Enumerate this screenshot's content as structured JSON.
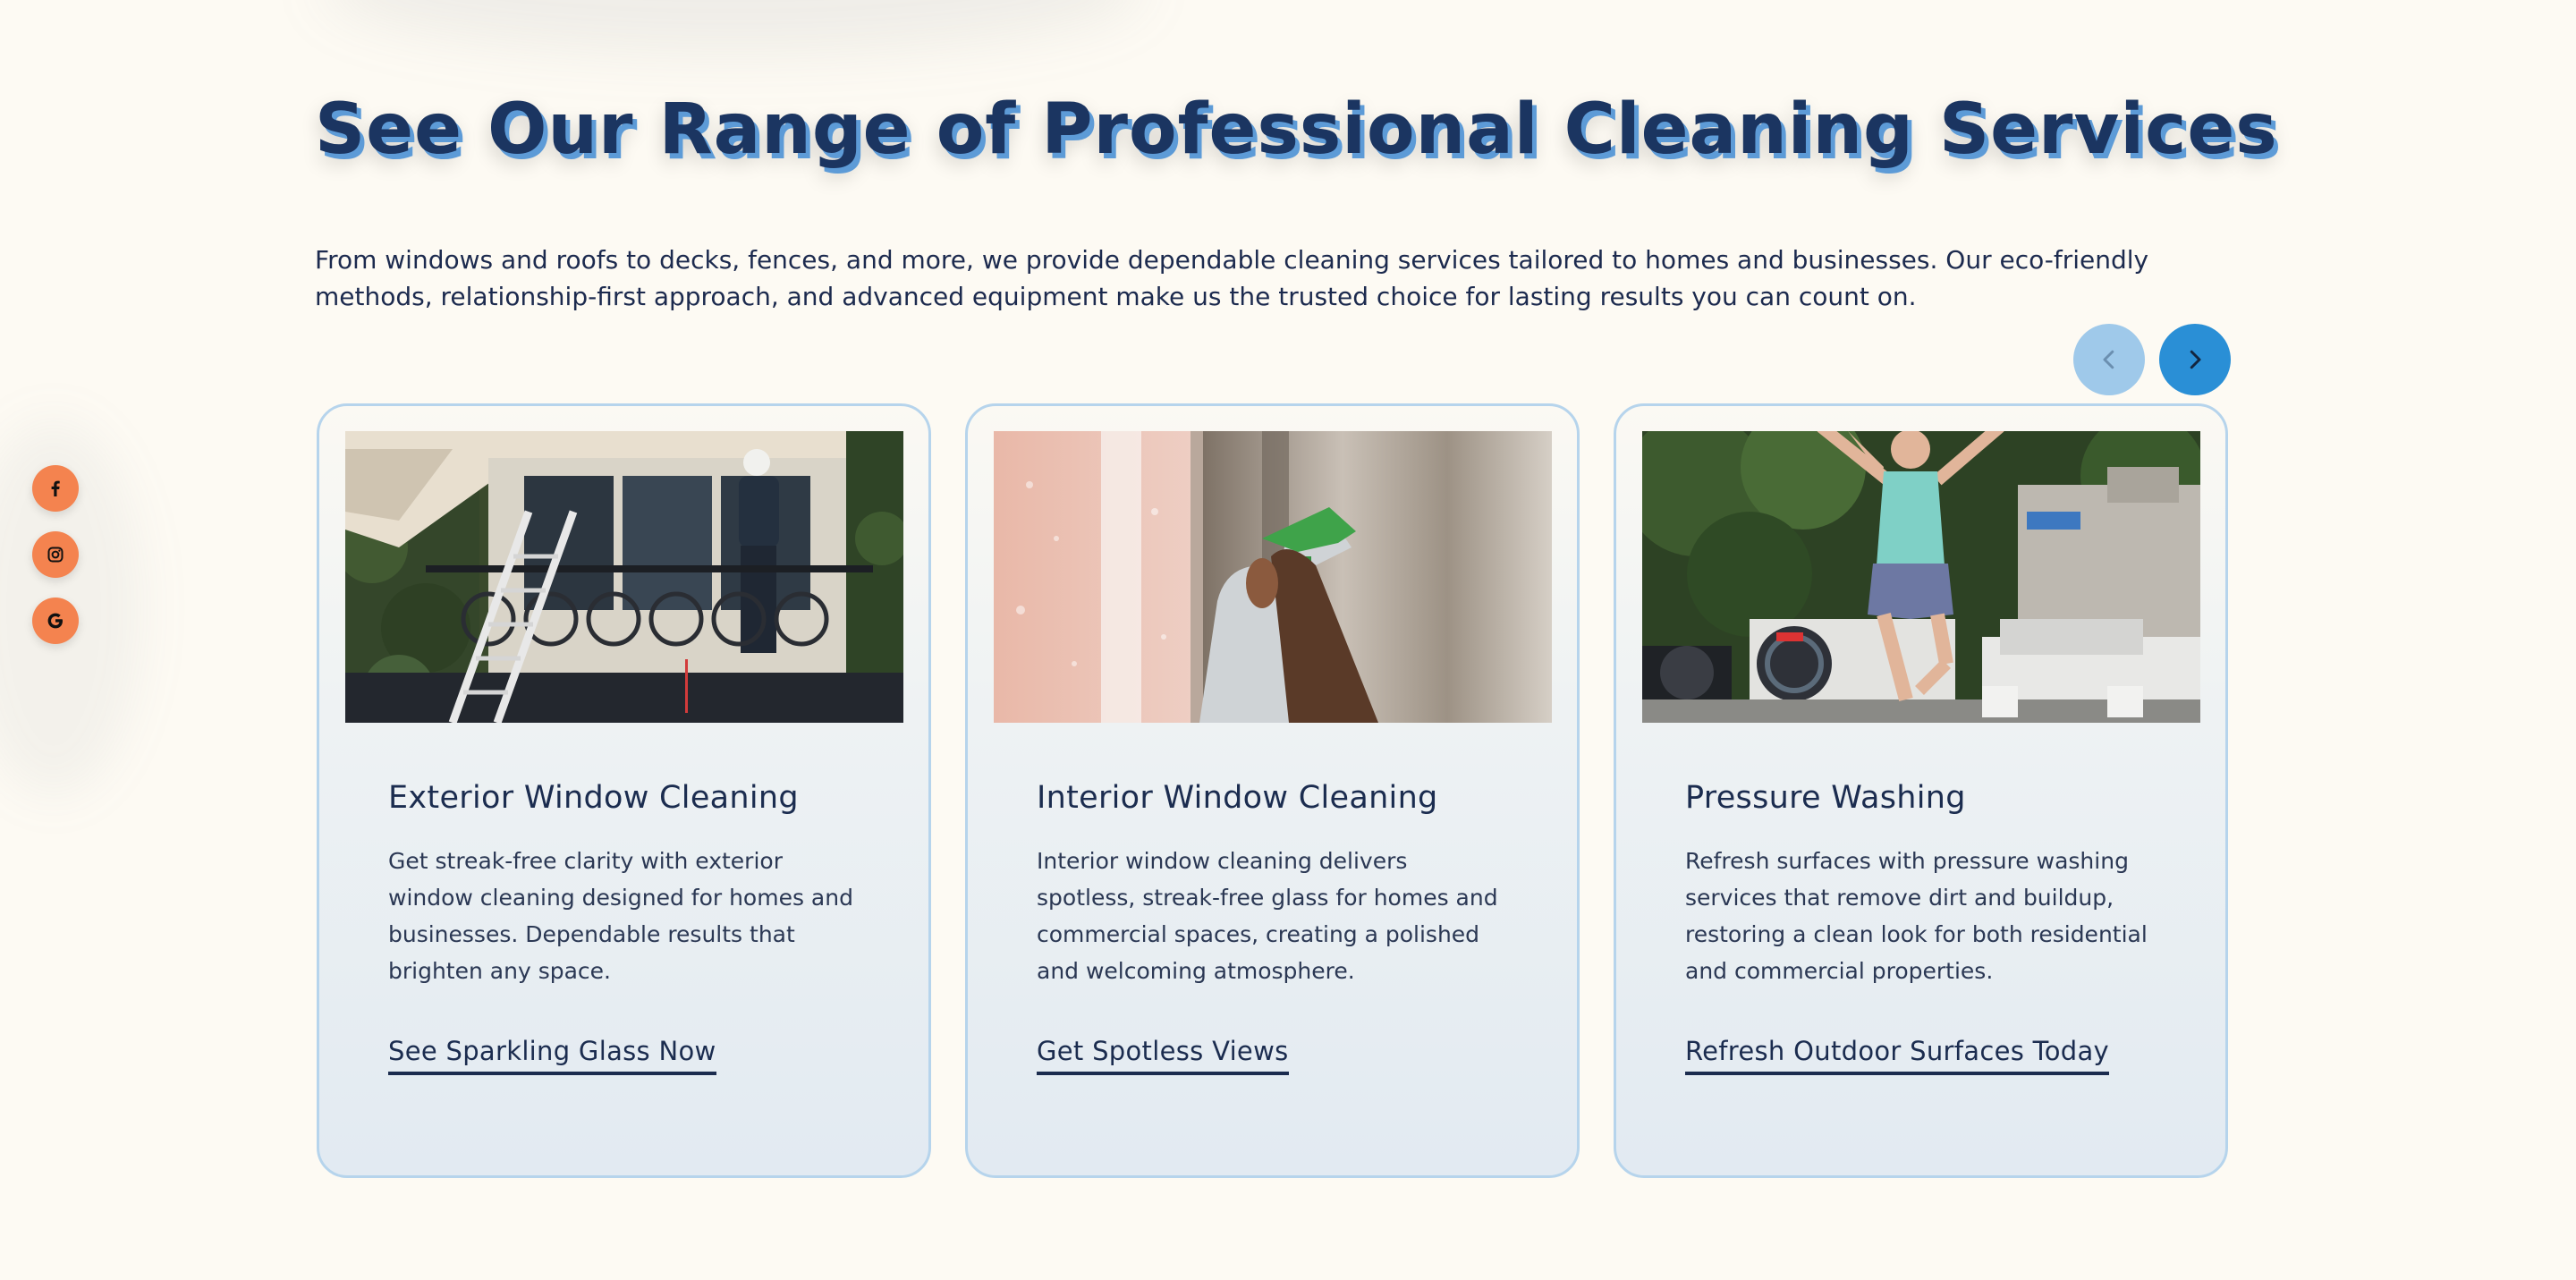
{
  "heading": "See Our Range of Professional Cleaning Services",
  "intro": "From windows and roofs to decks, fences, and more, we provide dependable cleaning services tailored to homes and businesses. Our eco-friendly methods, relationship-first approach, and advanced equipment make us the trusted choice for lasting results you can count on.",
  "social": [
    {
      "name": "facebook",
      "icon": "facebook-icon"
    },
    {
      "name": "instagram",
      "icon": "instagram-icon"
    },
    {
      "name": "google",
      "icon": "google-icon"
    }
  ],
  "carousel": {
    "prev_icon": "chevron-left-icon",
    "next_icon": "chevron-right-icon"
  },
  "cards": [
    {
      "image": "photo-worker-cleaning-balcony-windows",
      "title": "Exterior Window Cleaning",
      "description": "Get streak-free clarity with exterior window cleaning designed for homes and businesses. Dependable results that brighten any space.",
      "link": "See Sparkling Glass Now"
    },
    {
      "image": "photo-hand-spraying-window",
      "title": "Interior Window Cleaning",
      "description": "Interior window cleaning delivers spotless, streak-free glass for homes and commercial spaces, creating a polished and welcoming atmosphere.",
      "link": "Get Spotless Views"
    },
    {
      "image": "photo-man-jumping-pressure-washer-truck",
      "title": "Pressure Washing",
      "description": "Refresh surfaces with pressure washing services that remove dirt and buildup, restoring a clean look for both residential and commercial properties.",
      "link": "Refresh Outdoor Surfaces Today"
    }
  ],
  "colors": {
    "background": "#fdfaf3",
    "heading": "#1b3561",
    "heading_shadow": "#5d9bd7",
    "social": "#f4834f",
    "nav_active": "#2a8fd6",
    "nav_disabled": "#9fc9ea",
    "card_border": "#b6d4ec"
  }
}
